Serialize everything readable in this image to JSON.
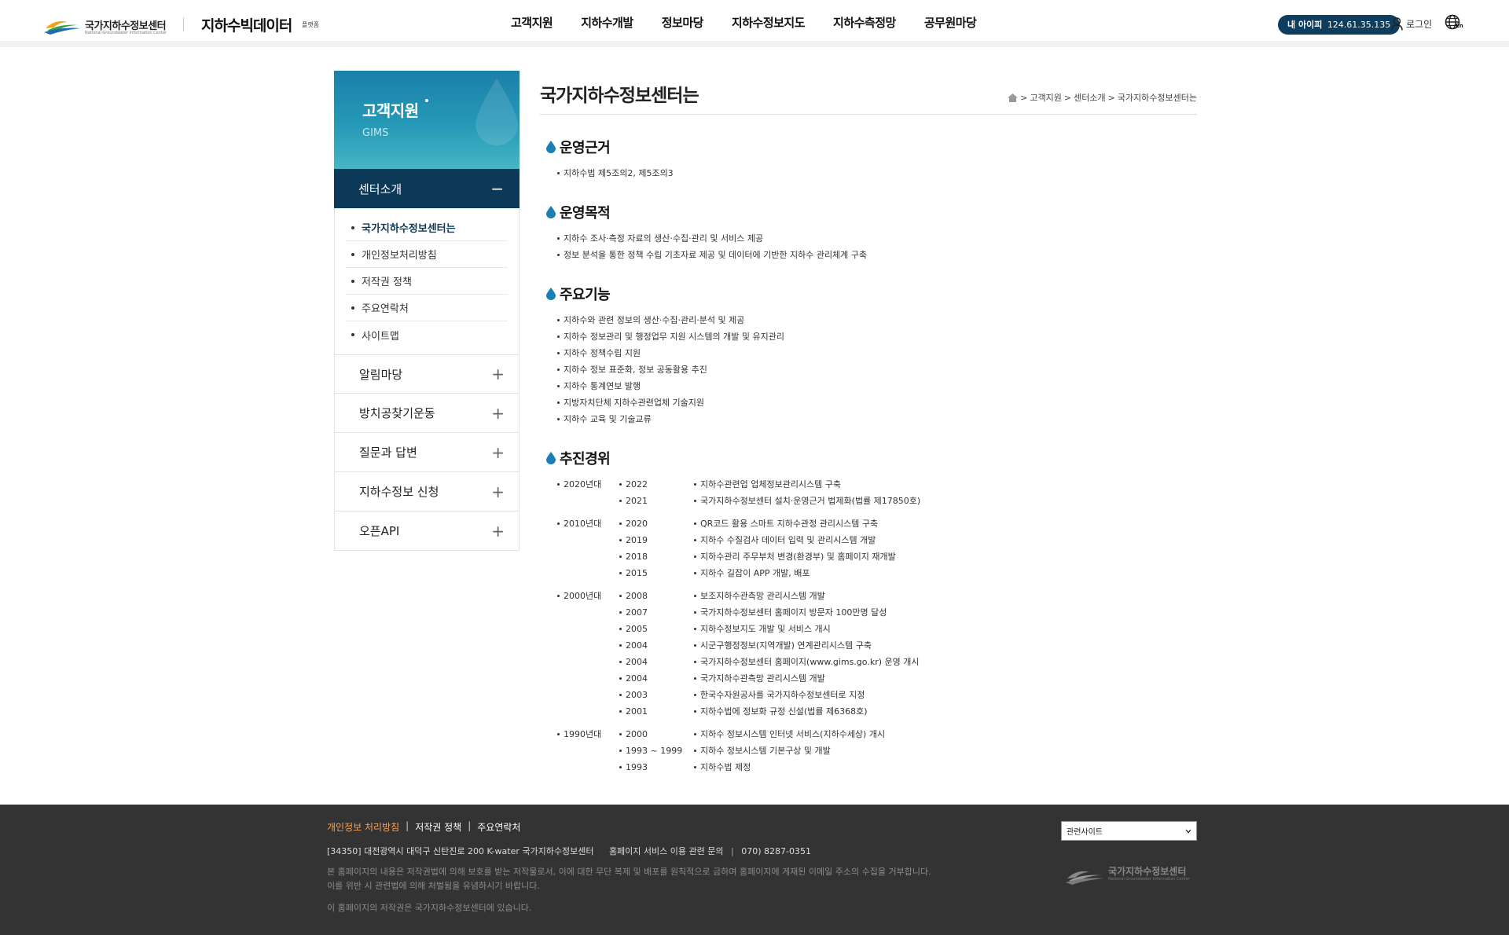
{
  "header": {
    "logo_name": "국가지하수정보센터",
    "logo_sub": "National Groundwater Information Center",
    "platform_logo": "지하수빅데이터",
    "platform_suffix": "플랫폼",
    "nav": [
      "고객지원",
      "지하수개발",
      "정보마당",
      "지하수정보지도",
      "지하수측정망",
      "공무원마당"
    ],
    "ip_label": "내 아이피",
    "ip_value": "124.61.35.135",
    "login_label": "로그인",
    "lang_label": "En",
    "icons": [
      "user-icon",
      "globe-icon"
    ]
  },
  "sidebar": {
    "title": "고객지원",
    "subtitle": "GIMS",
    "active_section": "센터소개",
    "sub_items": [
      "국가지하수정보센터는",
      "개인정보처리방침",
      "저작권 정책",
      "주요연락처",
      "사이트맵"
    ],
    "selected_sub": 0,
    "sections": [
      "알림마당",
      "방치공찾기운동",
      "질문과 답변",
      "지하수정보 신청",
      "오픈API"
    ]
  },
  "page": {
    "title": "국가지하수정보센터는",
    "breadcrumb": [
      "고객지원",
      "센터소개",
      "국가지하수정보센터는"
    ]
  },
  "sections": {
    "basis": {
      "title": "운영근거",
      "items": [
        "지하수법 제5조의2, 제5조의3"
      ]
    },
    "purpose": {
      "title": "운영목적",
      "items": [
        "지하수 조사·측정 자료의 생산·수집·관리 및 서비스 제공",
        "정보 분석을 통한 정책 수립 기초자료 제공 및 데이터에 기반한 지하수 관리체계 구축"
      ]
    },
    "functions": {
      "title": "주요기능",
      "items": [
        "지하수와 관련 정보의 생산·수집·관리·분석 및 제공",
        "지하수 정보관리 및 행정업무 지원 시스템의 개발 및 유지관리",
        "지하수 정책수립 지원",
        "지하수 정보 표준화, 정보 공동활용 추진",
        "지하수 통계연보 발행",
        "지방자치단체 지하수관련업체 기술지원",
        "지하수 교육 및 기술교류"
      ]
    },
    "history": {
      "title": "추진경위",
      "decades": [
        {
          "label": "2020년대",
          "events": [
            {
              "year": "2022",
              "text": "지하수관련업 업체정보관리시스템 구축"
            },
            {
              "year": "2021",
              "text": "국가지하수정보센터 설치·운영근거 법제화(법률 제17850호)"
            }
          ]
        },
        {
          "label": "2010년대",
          "events": [
            {
              "year": "2020",
              "text": "QR코드 활용 스마트 지하수관정 관리시스템 구축"
            },
            {
              "year": "2019",
              "text": "지하수 수질검사 데이터 입력 및 관리시스템 개발"
            },
            {
              "year": "2018",
              "text": "지하수관리 주무부처 변경(환경부) 및 홈페이지 재개발"
            },
            {
              "year": "2015",
              "text": "지하수 길잡이 APP 개발, 배포"
            }
          ]
        },
        {
          "label": "2000년대",
          "events": [
            {
              "year": "2008",
              "text": "보조지하수관측망 관리시스템 개발"
            },
            {
              "year": "2007",
              "text": "국가지하수정보센터 홈페이지 방문자 100만명 달성"
            },
            {
              "year": "2005",
              "text": "지하수정보지도 개발 및 서비스 개시"
            },
            {
              "year": "2004",
              "text": "시군구행정정보(지역개발) 연계관리시스템 구축"
            },
            {
              "year": "2004",
              "text": "국가지하수정보센터 홈페이지(www.gims.go.kr) 운영 개시"
            },
            {
              "year": "2004",
              "text": "국가지하수관측망 관리시스템 개발"
            },
            {
              "year": "2003",
              "text": "한국수자원공사를 국가지하수정보센터로 지정"
            },
            {
              "year": "2001",
              "text": "지하수법에 정보화 규정 신설(법률 제6368호)"
            }
          ]
        },
        {
          "label": "1990년대",
          "events": [
            {
              "year": "2000",
              "text": "지하수 정보시스템 인터넷 서비스(지하수세상) 개시"
            },
            {
              "year": "1993 ~ 1999",
              "text": "지하수 정보시스템 기본구상 및 개발"
            },
            {
              "year": "1993",
              "text": "지하수법 제정"
            }
          ]
        }
      ]
    }
  },
  "footer": {
    "links": [
      "개인정보 처리방침",
      "저작권 정책",
      "주요연락처"
    ],
    "address": "[34350] 대전광역시 대덕구 신탄진로 200 K-water 국가지하수정보센터",
    "inquiry_label": "홈페이지 서비스 이용 관련 문의",
    "phone": "070) 8287-0351",
    "notice_1": "본 홈페이지의 내용은 저작권법에 의해 보호를 받는 저작물로서, 이에 대한 무단 복제 및 배포를 원칙적으로 금하며 홈페이지에 게재된 이메일 주소의 수집을 거부합니다.",
    "notice_2": "이를 위반 시 관련법에 의해 처벌됨을 유념하시기 바랍니다.",
    "copyright": "이 홈페이지의 저작권은 국가지하수정보센터에 있습니다.",
    "related_sites": "관련사이트",
    "logo_name": "국가지하수정보센터",
    "logo_sub": "National Groundwater Information Center"
  },
  "colors": {
    "navy": "#0c3957",
    "teal": "#2599b7",
    "drop": "#1a7fb5",
    "footer_bg": "#333333",
    "footer_highlight": "#f7a35c"
  }
}
